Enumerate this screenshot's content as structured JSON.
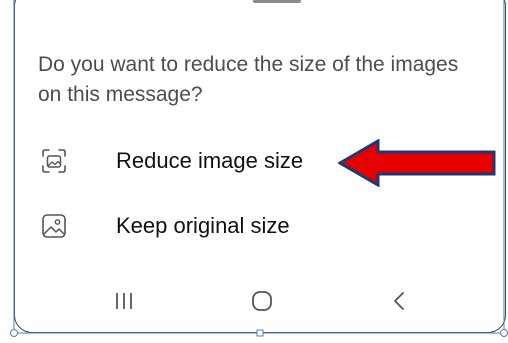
{
  "dialog": {
    "question": "Do you want to reduce the size of the images on this message?",
    "options": [
      {
        "label": "Reduce image size",
        "icon": "image-reduce-icon"
      },
      {
        "label": "Keep original size",
        "icon": "image-icon"
      }
    ]
  },
  "navbar": {
    "buttons": [
      "recents-icon",
      "home-icon",
      "back-icon"
    ]
  },
  "annotation": {
    "arrow_color": "#e60000",
    "arrow_outline": "#1f3a6e"
  }
}
